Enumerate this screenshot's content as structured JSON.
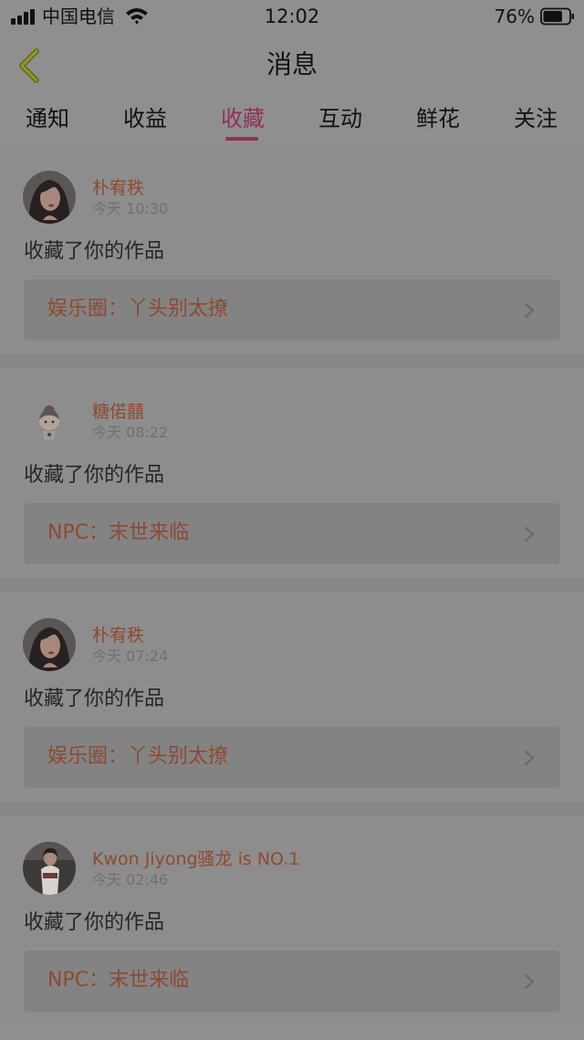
{
  "status_bar": {
    "carrier": "中国电信",
    "time": "12:02",
    "battery": "76%",
    "battery_level": 0.76
  },
  "nav": {
    "title": "消息"
  },
  "tabs": [
    {
      "label": "通知",
      "active": false
    },
    {
      "label": "收益",
      "active": false
    },
    {
      "label": "收藏",
      "active": true
    },
    {
      "label": "互动",
      "active": false
    },
    {
      "label": "鲜花",
      "active": false
    },
    {
      "label": "关注",
      "active": false
    }
  ],
  "feed": [
    {
      "username": "朴宥秩",
      "time": "今天 10:30",
      "action": "收藏了你的作品",
      "work": "娱乐圈：丫头别太撩"
    },
    {
      "username": "糖偌囍",
      "time": "今天 08:22",
      "action": "收藏了你的作品",
      "work": "NPC：末世来临"
    },
    {
      "username": "朴宥秩",
      "time": "今天 07:24",
      "action": "收藏了你的作品",
      "work": "娱乐圈：丫头别太撩"
    },
    {
      "username": "Kwon Jiyong骚龙 is NO.1",
      "time": "今天 02:46",
      "action": "收藏了你的作品",
      "work": "NPC：末世来临"
    }
  ],
  "colors": {
    "accent": "#91305a",
    "username": "#8f4a2e",
    "background": "#8f8f8f",
    "back_arrow": "#6b6b1c"
  }
}
